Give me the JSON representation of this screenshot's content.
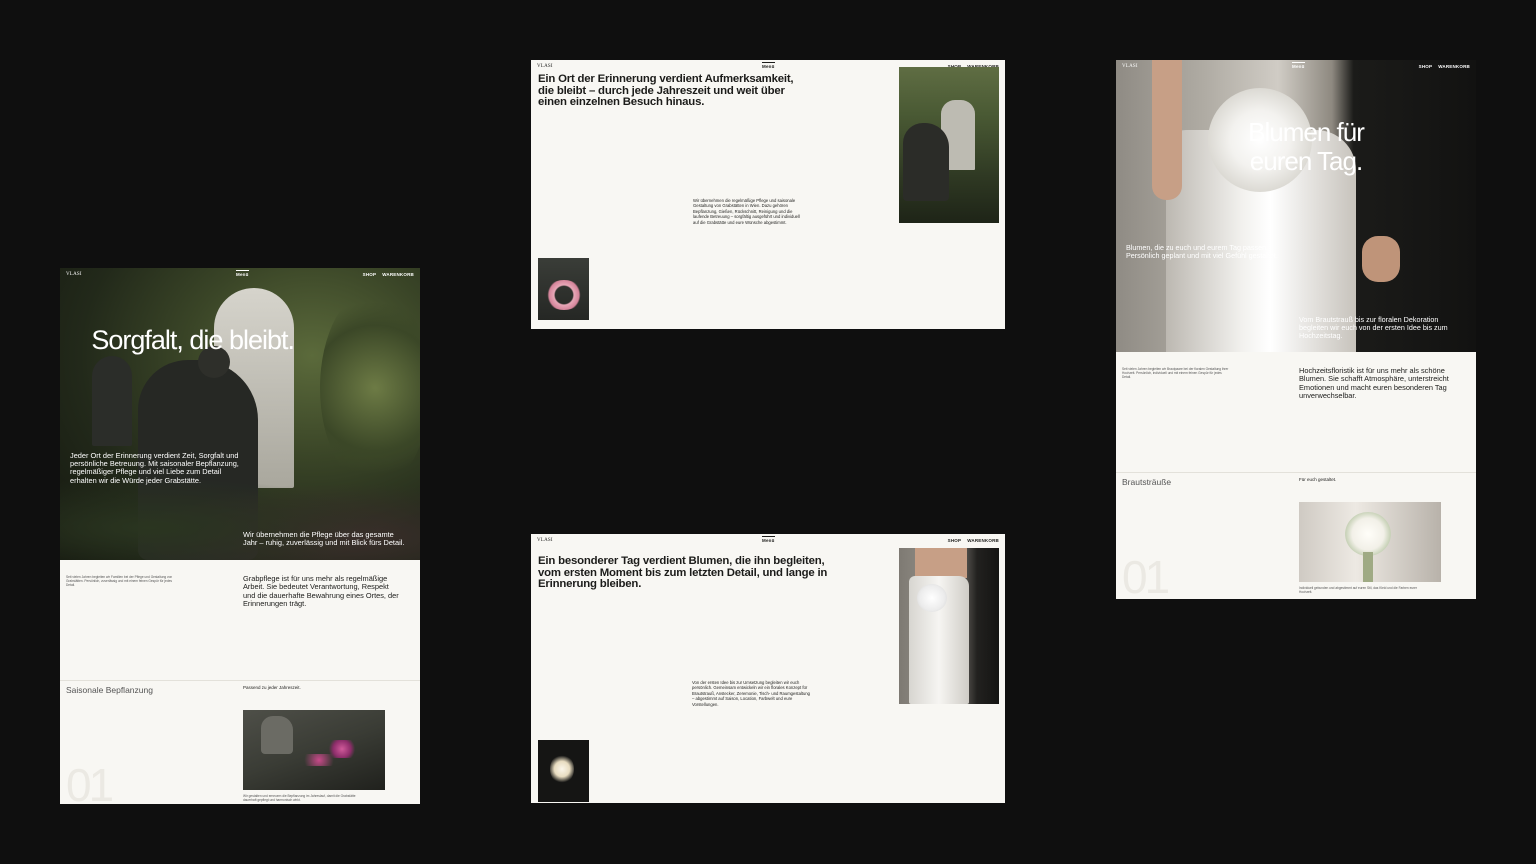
{
  "nav": {
    "logo": "VLASI",
    "menu": "Menü",
    "shop": "SHOP",
    "cart": "WARENKORB"
  },
  "grave_page": {
    "hero_title": "Sorgfalt, die bleibt.",
    "hero_intro": "Jeder Ort der Erinnerung verdient Zeit, Sorgfalt und persönliche Betreuung. Mit saisonaler Bepflanzung, regelmäßiger Pflege und viel Liebe zum Detail erhalten wir die Würde jeder Grabstätte.",
    "hero_second": "Wir übernehmen die Pflege über das gesamte Jahr – ruhig, zuverlässig und mit Blick fürs Detail.",
    "small_text": "Seit vielen Jahren begleiten wir Familien bei der Pflege und Gestaltung von Grabstätten. Persönlich, zuverlässig und mit einem feinen Gespür für jedes Detail.",
    "lead": "Grabpflege ist für uns mehr als regelmäßige Arbeit. Sie bedeutet Verantwortung, Respekt und die dauerhafte Bewahrung eines Ortes, der Erinnerungen trägt.",
    "category": "Saisonale Bepflanzung",
    "category_sub": "Passend zu jeder Jahreszeit.",
    "number": "01",
    "caption": "Wir gestalten und erneuern die Bepflanzung im Jahreslauf, damit die Grabstätte dauerhaft gepflegt und harmonisch wirkt."
  },
  "grave_text_page": {
    "headline": "Ein Ort der Erinnerung verdient Aufmerksamkeit, die bleibt – durch jede Jahreszeit und weit über einen einzelnen Besuch hinaus.",
    "body": "Wir übernehmen die regelmäßige Pflege und saisonale Gestaltung von Grabstätten in Wien. Dazu gehören Bepflanzung, Gießen, Rückschnitt, Reinigung und die laufende Betreuung – sorgfältig ausgeführt und individuell auf die Grabstätte und eure Wünsche abgestimmt."
  },
  "wedding_text_page": {
    "headline": "Ein besonderer Tag verdient Blumen, die ihn begleiten, vom ersten Moment bis zum letzten Detail, und lange in Erinnerung bleiben.",
    "body": "Von der ersten Idee bis zur Umsetzung begleiten wir euch persönlich. Gemeinsam entwickeln wir ein florales Konzept für Brautstrauß, Anstecker, Zeremonie, Tisch- und Raumgestaltung – abgestimmt auf Saison, Location, Farbwelt und eure Vorstellungen."
  },
  "wedding_page": {
    "hero_title": "Blumen für euren Tag.",
    "hero_intro": "Blumen, die zu euch und eurem Tag passen. Persönlich geplant und mit viel Gefühl gestaltet.",
    "hero_second": "Vom Brautstrauß bis zur floralen Dekoration begleiten wir euch von der ersten Idee bis zum Hochzeitstag.",
    "small_text": "Seit vielen Jahren begleiten wir Brautpaare bei der floralen Gestaltung ihrer Hochzeit. Persönlich, individuell und mit einem feinen Gespür für jedes Detail.",
    "lead": "Hochzeitsfloristik ist für uns mehr als schöne Blumen. Sie schafft Atmosphäre, unterstreicht Emotionen und macht euren besonderen Tag unverwechselbar.",
    "category": "Brautsträuße",
    "category_sub": "Für euch gestaltet.",
    "number": "01",
    "caption": "Individuell gebunden und abgestimmt auf euren Stil, das Kleid und die Farben eurer Hochzeit."
  }
}
